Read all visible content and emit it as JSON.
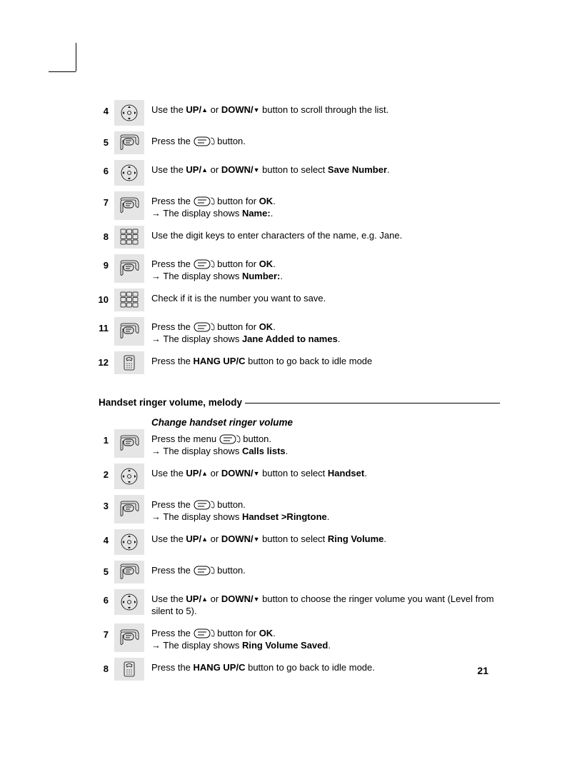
{
  "pageNumber": "21",
  "section1": {
    "steps": [
      {
        "n": "4",
        "icon": "nav",
        "parts": [
          "Use the ",
          {
            "b": "UP/"
          },
          {
            "tri": "up"
          },
          " or ",
          {
            "b": "DOWN/"
          },
          {
            "tri": "dn"
          },
          " button to scroll through the list."
        ]
      },
      {
        "n": "5",
        "icon": "menu",
        "parts": [
          "Press the ",
          {
            "ic": "menu"
          },
          " button."
        ]
      },
      {
        "n": "6",
        "icon": "nav",
        "parts": [
          "Use the ",
          {
            "b": "UP/"
          },
          {
            "tri": "up"
          },
          " or ",
          {
            "b": "DOWN/"
          },
          {
            "tri": "dn"
          },
          " button to select ",
          {
            "b": "Save Number"
          },
          "."
        ]
      },
      {
        "n": "7",
        "icon": "menu",
        "parts": [
          "Press the ",
          {
            "ic": "menu"
          },
          " button for ",
          {
            "b": "OK"
          },
          "."
        ],
        "sub": [
          "The display shows ",
          {
            "b": "Name:"
          },
          "."
        ]
      },
      {
        "n": "8",
        "icon": "keypad",
        "parts": [
          "Use the digit keys to enter characters of the name, e.g. Jane."
        ]
      },
      {
        "n": "9",
        "icon": "menu",
        "parts": [
          "Press the ",
          {
            "ic": "menu"
          },
          " button for ",
          {
            "b": "OK"
          },
          "."
        ],
        "sub": [
          "The display shows ",
          {
            "b": "Number:"
          },
          "."
        ]
      },
      {
        "n": "10",
        "icon": "keypad",
        "parts": [
          "Check if  it is the number you want to save."
        ]
      },
      {
        "n": "11",
        "icon": "menu",
        "parts": [
          "Press the ",
          {
            "ic": "menu"
          },
          " button for ",
          {
            "b": "OK"
          },
          "."
        ],
        "sub": [
          "The display shows ",
          {
            "b": "Jane Added to names"
          },
          "."
        ]
      },
      {
        "n": "12",
        "icon": "hangup",
        "parts": [
          "Press the ",
          {
            "b": "HANG UP/C"
          },
          " button to go back to idle mode"
        ]
      }
    ]
  },
  "section2": {
    "heading": "Handset ringer volume, melody",
    "subHeading": "Change handset ringer volume",
    "steps": [
      {
        "n": "1",
        "icon": "menu",
        "parts": [
          "Press the menu ",
          {
            "ic": "menu"
          },
          " button."
        ],
        "sub": [
          "The display shows ",
          {
            "b": "Calls lists"
          },
          "."
        ]
      },
      {
        "n": "2",
        "icon": "nav",
        "parts": [
          "Use the ",
          {
            "b": "UP/"
          },
          {
            "tri": "up"
          },
          " or ",
          {
            "b": "DOWN/"
          },
          {
            "tri": "dn"
          },
          " button to select ",
          {
            "b": "Handset"
          },
          "."
        ]
      },
      {
        "n": "3",
        "icon": "menu",
        "parts": [
          "Press the ",
          {
            "ic": "menu"
          },
          " button."
        ],
        "sub": [
          "The display shows ",
          {
            "b": "Handset >Ringtone"
          },
          "."
        ]
      },
      {
        "n": "4",
        "icon": "nav",
        "parts": [
          "Use the ",
          {
            "b": "UP/"
          },
          {
            "tri": "up"
          },
          " or ",
          {
            "b": "DOWN/"
          },
          {
            "tri": "dn"
          },
          " button to select ",
          {
            "b": "Ring Volume"
          },
          "."
        ]
      },
      {
        "n": "5",
        "icon": "menu",
        "parts": [
          "Press the ",
          {
            "ic": "menu"
          },
          " button."
        ]
      },
      {
        "n": "6",
        "icon": "nav",
        "parts": [
          "Use the ",
          {
            "b": "UP/"
          },
          {
            "tri": "up"
          },
          " or ",
          {
            "b": "DOWN/"
          },
          {
            "tri": "dn"
          },
          " button to choose the ringer volume you want (Level from silent to 5)."
        ]
      },
      {
        "n": "7",
        "icon": "menu",
        "parts": [
          "Press the ",
          {
            "ic": "menu"
          },
          " button for ",
          {
            "b": "OK"
          },
          "."
        ],
        "sub": [
          "The display shows ",
          {
            "b": "Ring Volume Saved"
          },
          "."
        ]
      },
      {
        "n": "8",
        "icon": "hangup",
        "parts": [
          "Press the ",
          {
            "b": "HANG UP/C"
          },
          " button to go back to idle mode."
        ]
      }
    ]
  }
}
